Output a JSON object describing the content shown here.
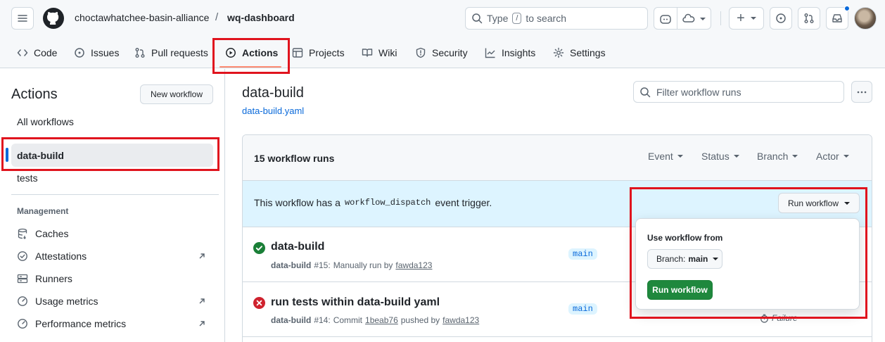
{
  "header": {
    "org": "choctawhatchee-basin-alliance",
    "separator": "/",
    "repo": "wq-dashboard",
    "search": {
      "prefix": "Type",
      "key": "/",
      "suffix": "to search"
    },
    "plus_label": "+"
  },
  "repo_nav": {
    "tabs": [
      {
        "label": "Code"
      },
      {
        "label": "Issues"
      },
      {
        "label": "Pull requests"
      },
      {
        "label": "Actions"
      },
      {
        "label": "Projects"
      },
      {
        "label": "Wiki"
      },
      {
        "label": "Security"
      },
      {
        "label": "Insights"
      },
      {
        "label": "Settings"
      }
    ],
    "active": "Actions"
  },
  "sidebar": {
    "title": "Actions",
    "new_workflow": "New workflow",
    "all_workflows": "All workflows",
    "workflows": [
      "data-build",
      "tests"
    ],
    "management_heading": "Management",
    "management": [
      {
        "label": "Caches",
        "icon": "cache-icon"
      },
      {
        "label": "Attestations",
        "icon": "attestation-icon"
      },
      {
        "label": "Runners",
        "icon": "server-icon"
      },
      {
        "label": "Usage metrics",
        "icon": "meter-icon"
      },
      {
        "label": "Performance metrics",
        "icon": "meter-icon"
      }
    ]
  },
  "main": {
    "title": "data-build",
    "file_link": "data-build.yaml",
    "filter_placeholder": "Filter workflow runs",
    "runs_count": "15 workflow runs",
    "filters": [
      "Event",
      "Status",
      "Branch",
      "Actor"
    ],
    "dispatch": {
      "text_before": "This workflow has a",
      "code": "workflow_dispatch",
      "text_after": "event trigger.",
      "button": "Run workflow"
    },
    "runs": [
      {
        "title": "data-build",
        "status": "success",
        "workflow": "data-build",
        "number": "#15:",
        "desc": "Manually run by",
        "user": "fawda123",
        "branch": "main"
      },
      {
        "title": "run tests within data-build yaml",
        "status": "failure",
        "workflow": "data-build",
        "number": "#14:",
        "desc": "Commit",
        "commit": "1beab76",
        "desc2": "pushed by",
        "user": "fawda123",
        "branch": "main",
        "result": "Failure"
      }
    ],
    "popover": {
      "label": "Use workflow from",
      "branch_prefix": "Branch:",
      "branch_value": "main",
      "submit": "Run workflow"
    }
  },
  "colors": {
    "accent": "#0969da",
    "success": "#1a7f37",
    "danger": "#cf222e",
    "highlight_box": "#e0141e",
    "active_tab_underline": "#fd8c73"
  }
}
